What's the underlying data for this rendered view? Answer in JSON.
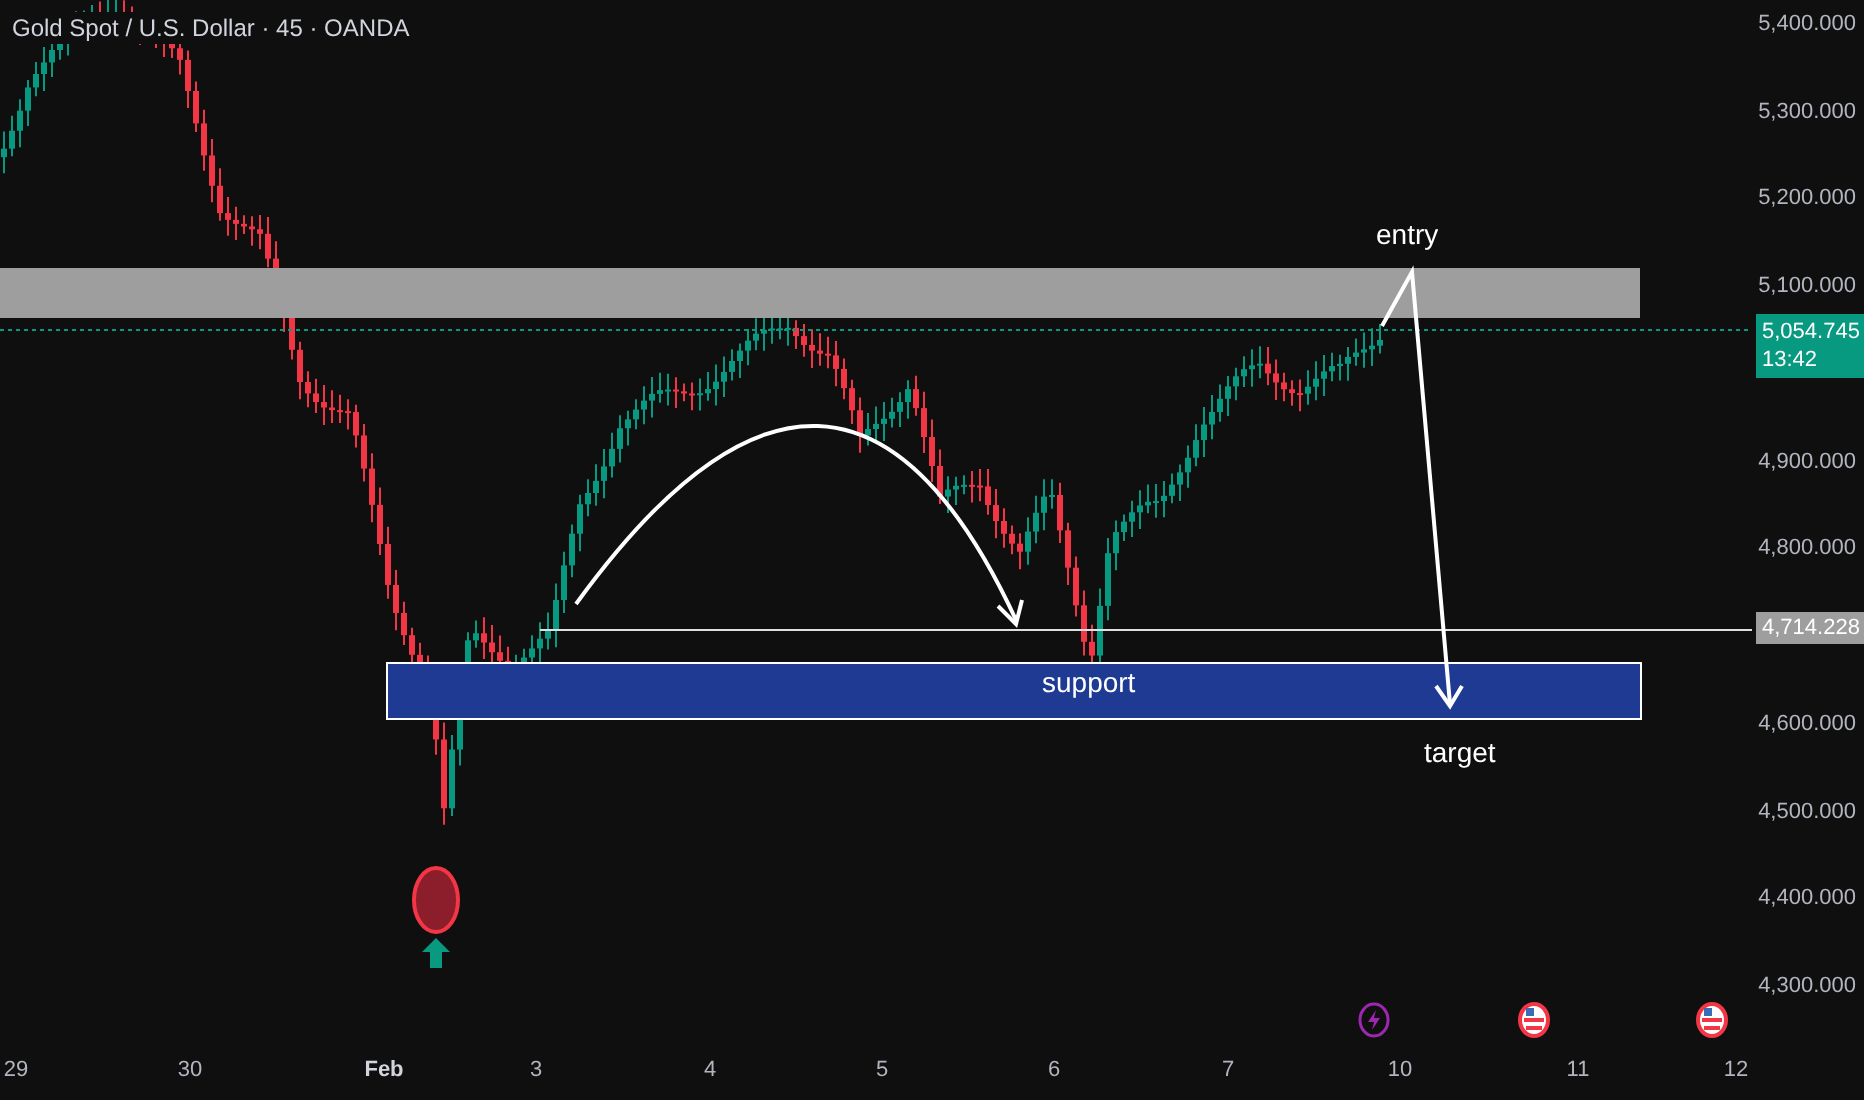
{
  "header": {
    "title": "Gold Spot / U.S. Dollar · 45 · OANDA"
  },
  "price_axis": {
    "ticks": [
      "5,400.000",
      "5,300.000",
      "5,200.000",
      "5,100.000",
      "4,900.000",
      "4,800.000",
      "4,600.000",
      "4,500.000",
      "4,400.000",
      "4,300.000"
    ],
    "current_price": {
      "value": "5,054.745",
      "countdown": "13:42"
    },
    "line_label": "4,714.228"
  },
  "annotations": {
    "entry": "entry",
    "support": "support",
    "target": "target"
  },
  "time_axis": {
    "ticks": [
      {
        "label": "29",
        "bold": false
      },
      {
        "label": "30",
        "bold": false
      },
      {
        "label": "Feb",
        "bold": true
      },
      {
        "label": "3",
        "bold": false
      },
      {
        "label": "4",
        "bold": false
      },
      {
        "label": "5",
        "bold": false
      },
      {
        "label": "6",
        "bold": false
      },
      {
        "label": "7",
        "bold": false
      },
      {
        "label": "10",
        "bold": false
      },
      {
        "label": "11",
        "bold": false
      },
      {
        "label": "12",
        "bold": false
      }
    ]
  },
  "events": [
    {
      "kind": "flash"
    },
    {
      "kind": "flag"
    },
    {
      "kind": "flag"
    }
  ]
}
